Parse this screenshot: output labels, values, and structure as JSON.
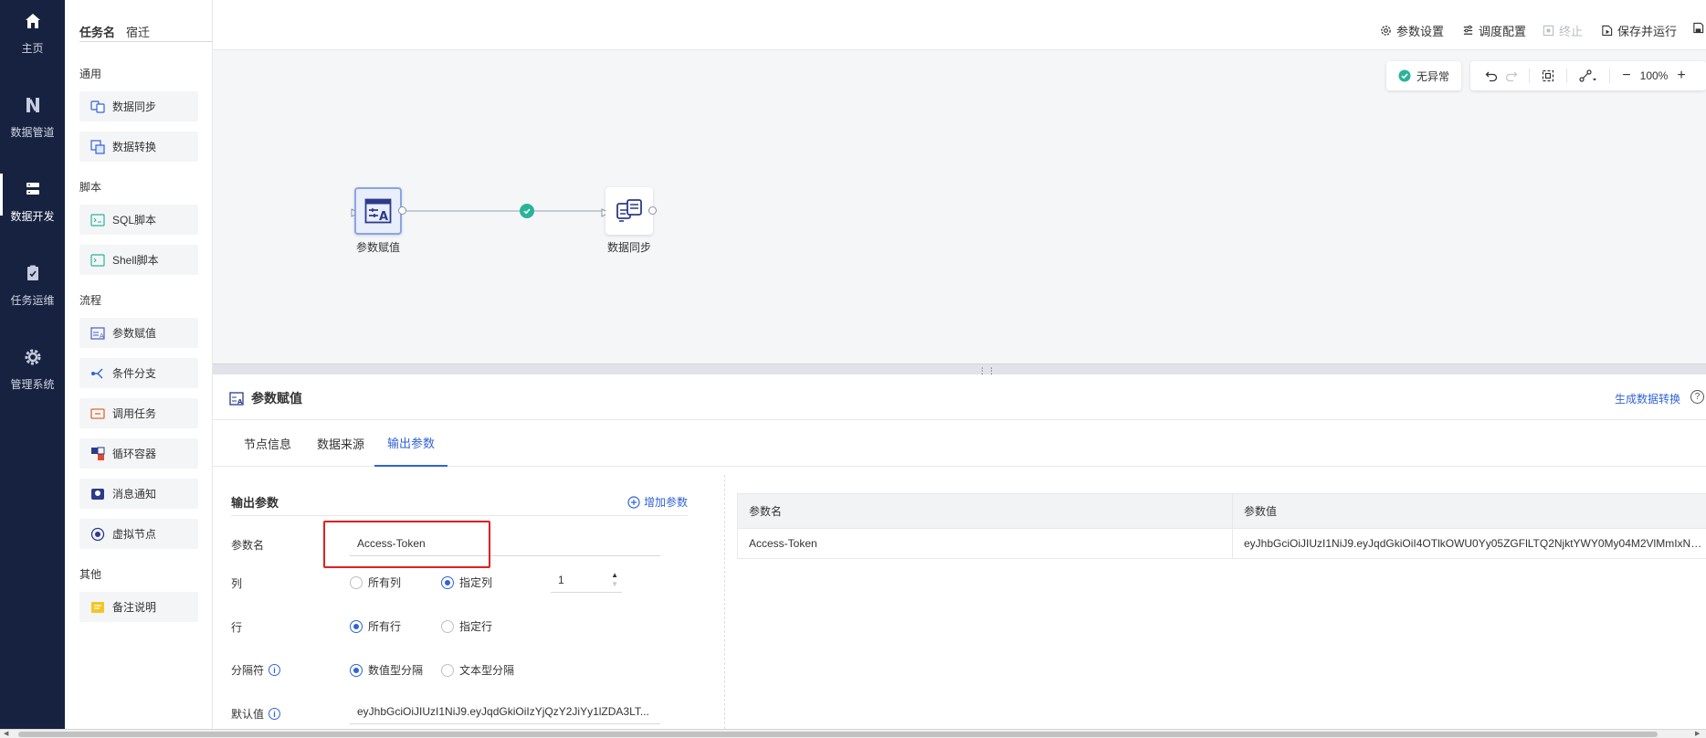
{
  "nav": {
    "items": [
      {
        "label": "主页",
        "icon": "home-icon"
      },
      {
        "label": "数据管道",
        "icon": "pipeline-icon"
      },
      {
        "label": "数据开发",
        "icon": "database-icon",
        "active": true
      },
      {
        "label": "任务运维",
        "icon": "clipboard-icon"
      },
      {
        "label": "管理系统",
        "icon": "gear-icon"
      }
    ]
  },
  "task": {
    "label": "任务名",
    "value": "宿迁"
  },
  "palette": {
    "sections": {
      "common": "通用",
      "script": "脚本",
      "flow": "流程",
      "other": "其他"
    },
    "items": {
      "data_sync": "数据同步",
      "data_transform": "数据转换",
      "sql_script": "SQL脚本",
      "shell_script": "Shell脚本",
      "param_assign": "参数赋值",
      "condition_branch": "条件分支",
      "call_task": "调用任务",
      "loop_container": "循环容器",
      "message_notify": "消息通知",
      "virtual_node": "虚拟节点",
      "remark": "备注说明"
    }
  },
  "toolbar": {
    "param_settings": "参数设置",
    "schedule_config": "调度配置",
    "stop": "终止",
    "save_run": "保存并运行"
  },
  "canvas": {
    "status": "无异常",
    "zoom": "100%",
    "nodes": {
      "source": "参数赋值",
      "target": "数据同步"
    }
  },
  "panel": {
    "title": "参数赋值",
    "gen_link": "生成数据转换",
    "tabs": [
      "节点信息",
      "数据来源",
      "输出参数"
    ],
    "active_tab": 2,
    "form": {
      "section_title": "输出参数",
      "add_param": "增加参数",
      "param_name_label": "参数名",
      "param_name_value": "Access-Token",
      "column_label": "列",
      "column_all": "所有列",
      "column_specific": "指定列",
      "column_index": "1",
      "row_label": "行",
      "row_all": "所有行",
      "row_specific": "指定行",
      "separator_label": "分隔符",
      "sep_numeric": "数值型分隔",
      "sep_text": "文本型分隔",
      "default_label": "默认值",
      "default_value": "eyJhbGciOiJIUzI1NiJ9.eyJqdGkiOiIzYjQzY2JiYy1lZDA3LT..."
    },
    "table": {
      "headers": [
        "参数名",
        "参数值"
      ],
      "rows": [
        [
          "Access-Token",
          "eyJhbGciOiJIUzI1NiJ9.eyJqdGkiOiI4OTlkOWU0Yy05ZGFlLTQ2NjktYWY0My04M2VlMmIxNzY2..."
        ]
      ]
    }
  },
  "colors": {
    "nav_bg": "#16223f",
    "accent": "#3163d8",
    "success": "#2ab39b",
    "highlight": "#e02020"
  }
}
